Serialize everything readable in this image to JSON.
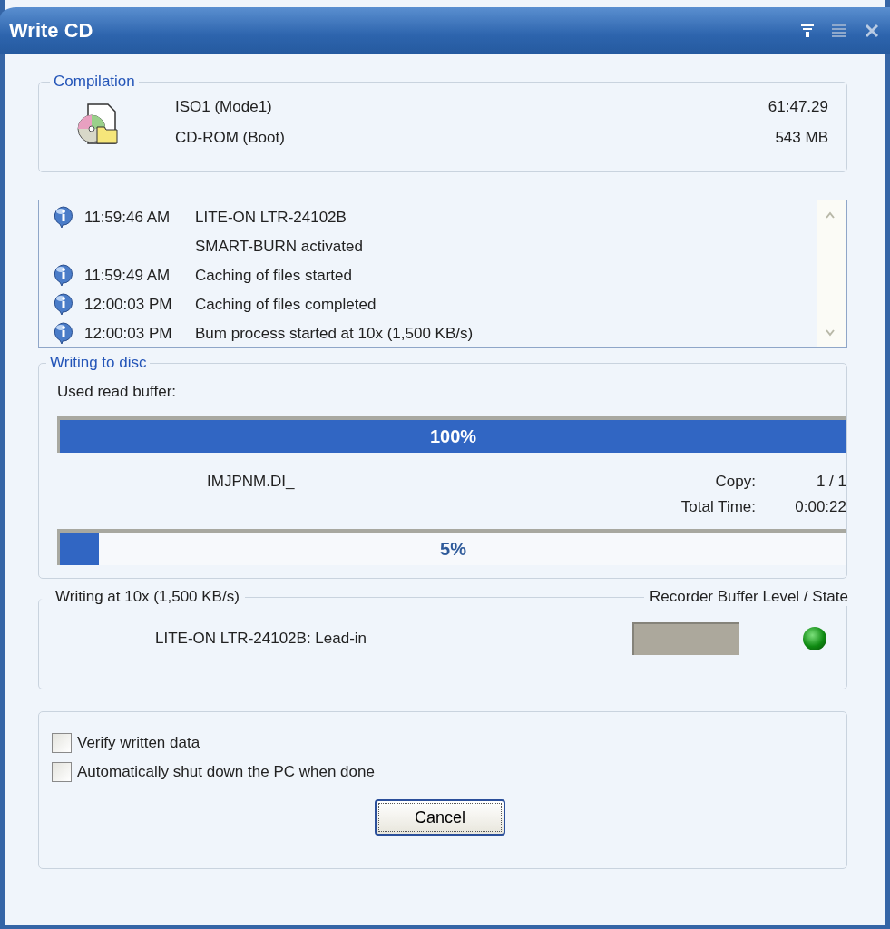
{
  "window": {
    "title": "Write CD"
  },
  "compilation": {
    "legend": "Compilation",
    "name": "ISO1 (Mode1)",
    "type": "CD-ROM (Boot)",
    "duration": "61:47.29",
    "size": "543 MB"
  },
  "log": [
    {
      "time": "11:59:46 AM",
      "lines": [
        "LITE-ON LTR-24102B",
        "SMART-BURN activated"
      ]
    },
    {
      "time": "11:59:49 AM",
      "lines": [
        "Caching of files started"
      ]
    },
    {
      "time": "12:00:03 PM",
      "lines": [
        "Caching of files completed"
      ]
    },
    {
      "time": "12:00:03 PM",
      "lines": [
        "Bum process started at 10x (1,500 KB/s)"
      ]
    }
  ],
  "writing": {
    "legend": "Writing to disc",
    "buffer_label": "Used read buffer:",
    "buffer": {
      "level": 1,
      "label": "100%"
    },
    "file": "IMJPNM.DI_",
    "copy_label": "Copy:",
    "copy": "1 / 1",
    "time_label": "Total Time:",
    "time": "0:00:22",
    "progress": {
      "level": 0.05,
      "label": "5%"
    }
  },
  "recorder": {
    "legend": "Writing at 10x (1,500 KB/s)",
    "legend_right": "Recorder Buffer Level / State",
    "status": "LITE-ON LTR-24102B: Lead-in",
    "led_on": true
  },
  "options": [
    {
      "label": "Verify written data",
      "checked": false
    },
    {
      "label": "Automatically shut down the PC when done",
      "checked": false
    }
  ],
  "cancel_button": "Cancel"
}
